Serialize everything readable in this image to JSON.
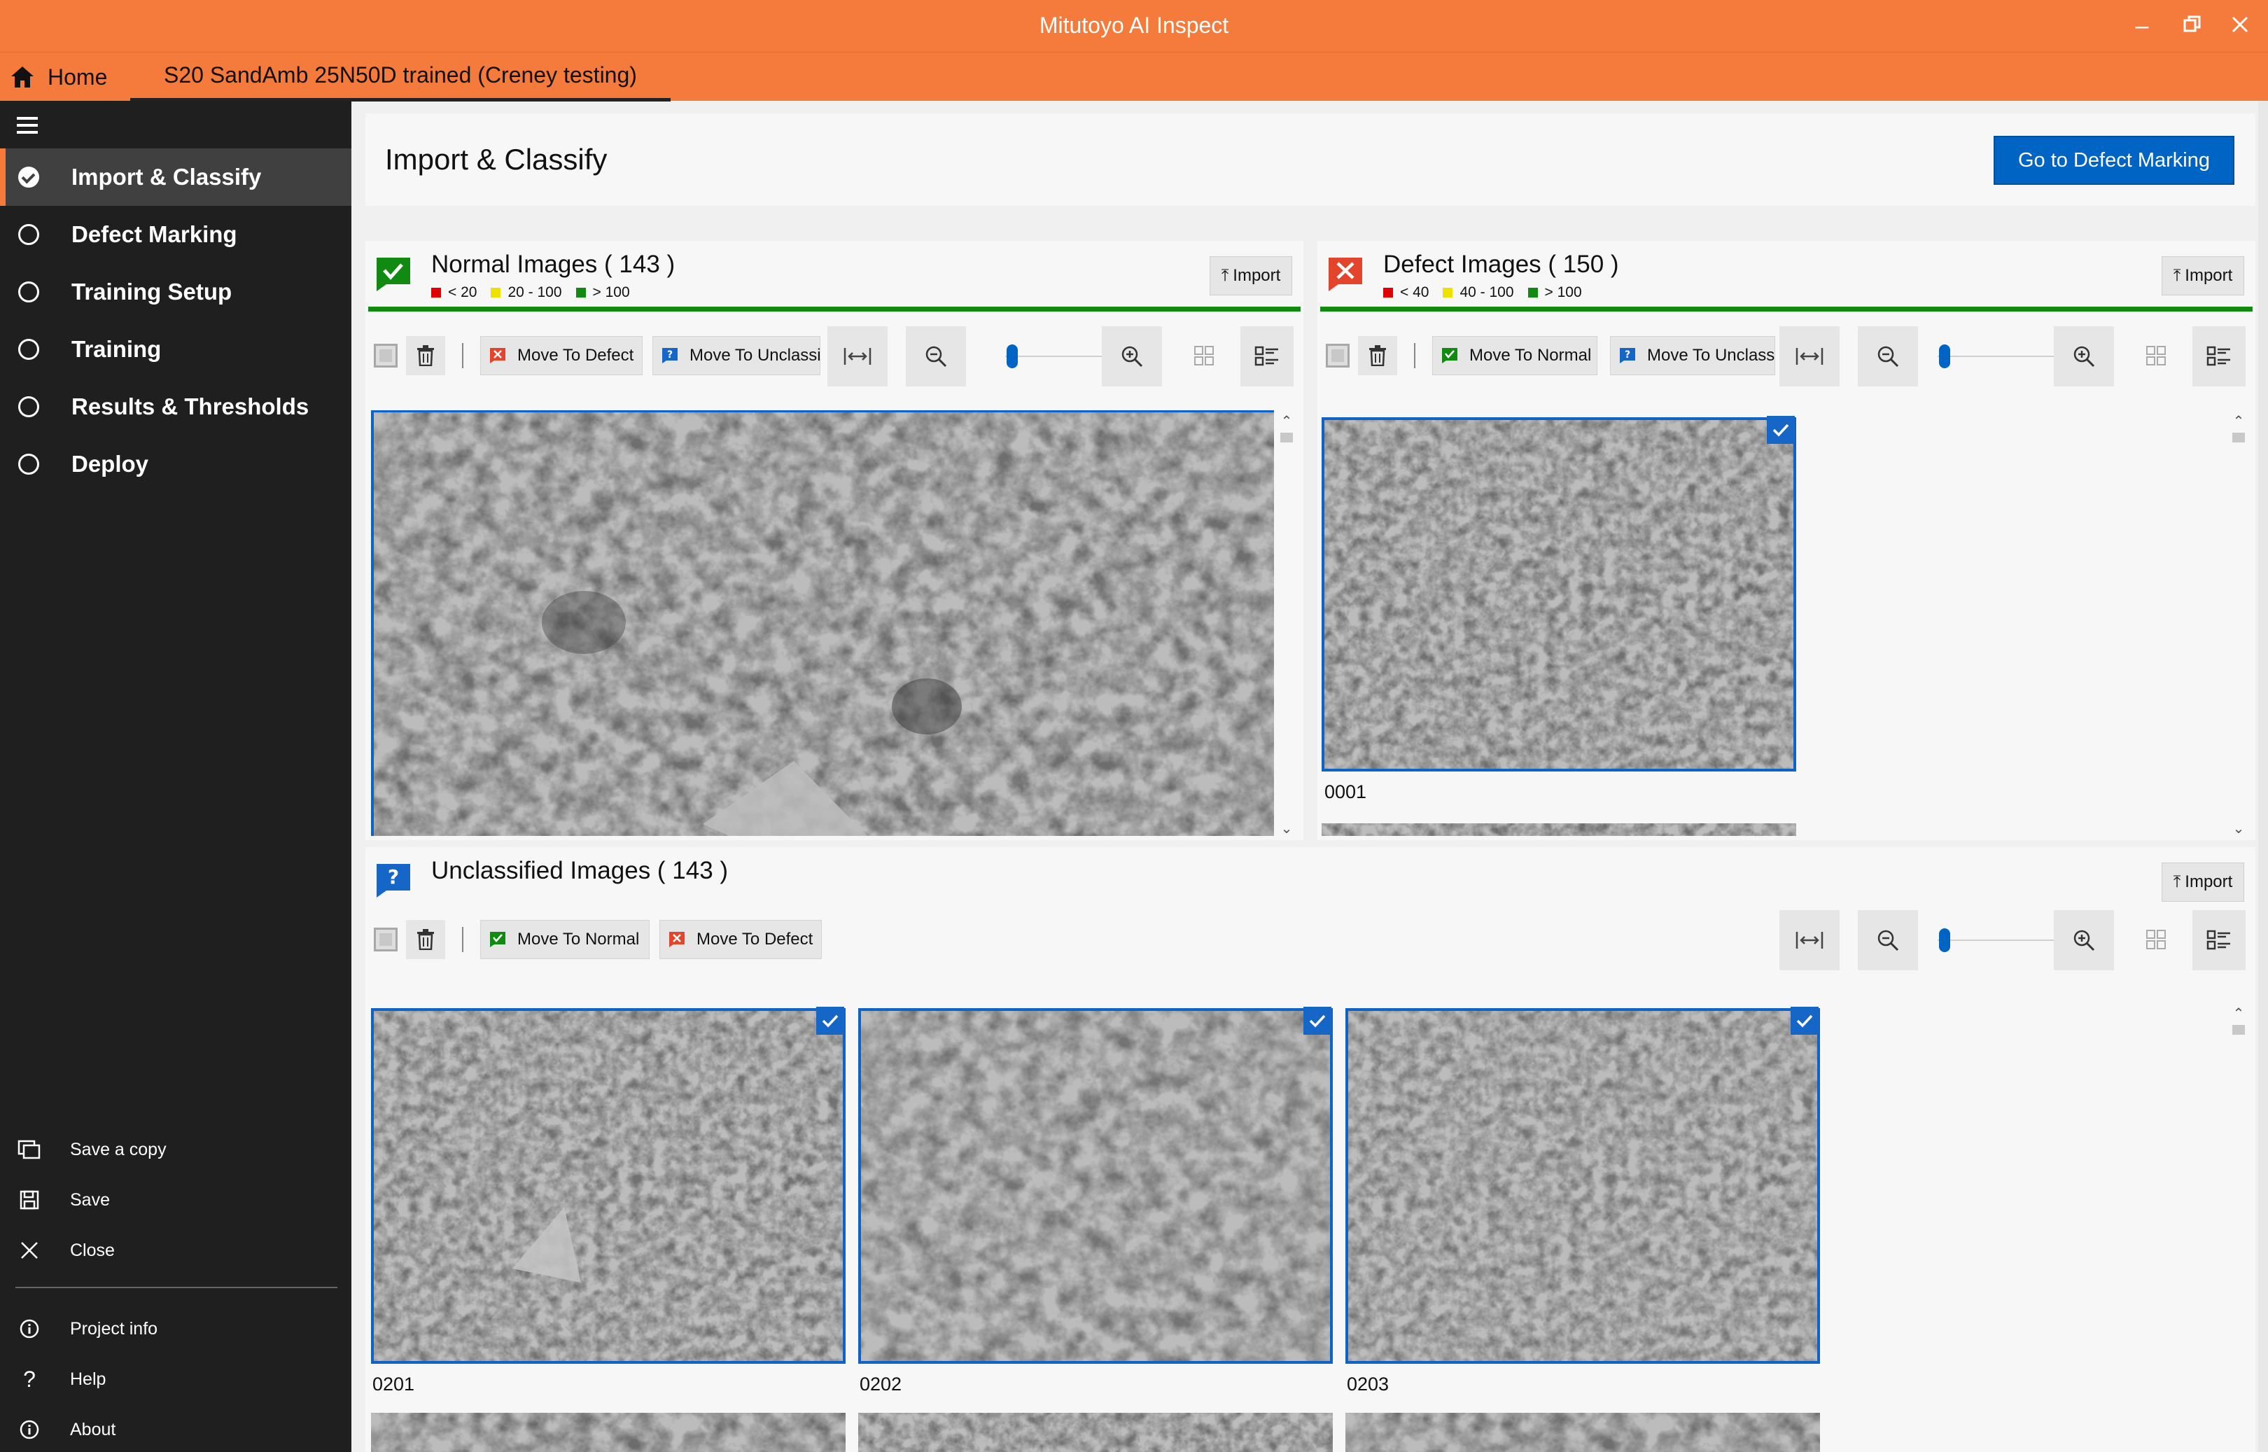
{
  "app": {
    "title": "Mitutoyo AI Inspect"
  },
  "tabs": {
    "home": "Home",
    "project": "S20 SandAmb 25N50D trained (Creney testing)"
  },
  "sidebar": {
    "items": [
      {
        "label": "Import & Classify",
        "active": true
      },
      {
        "label": "Defect Marking"
      },
      {
        "label": "Training Setup"
      },
      {
        "label": "Training"
      },
      {
        "label": "Results & Thresholds"
      },
      {
        "label": "Deploy"
      }
    ],
    "bottom": {
      "save_copy": "Save a copy",
      "save": "Save",
      "close": "Close",
      "project_info": "Project info",
      "help": "Help",
      "about": "About"
    }
  },
  "header": {
    "title": "Import & Classify",
    "action": "Go to Defect Marking"
  },
  "normal": {
    "title": "Normal Images ( 143 )",
    "legend": [
      "< 20",
      "20 - 100",
      "> 100"
    ],
    "import": "Import",
    "move_defect": "Move To Defect",
    "move_unclassified": "Move To Unclassified"
  },
  "defect": {
    "title": "Defect Images ( 150 )",
    "legend": [
      "< 40",
      "40 - 100",
      "> 100"
    ],
    "import": "Import",
    "move_normal": "Move To Normal",
    "move_unclassified": "Move To Unclassified",
    "images": [
      {
        "label": "0001"
      }
    ]
  },
  "unclassified": {
    "title": "Unclassified Images ( 143 )",
    "import": "Import",
    "move_normal": "Move To Normal",
    "move_defect": "Move To Defect",
    "images": [
      {
        "label": "0201"
      },
      {
        "label": "0202"
      },
      {
        "label": "0203"
      }
    ]
  },
  "colors": {
    "accent": "#f47b3b",
    "primary": "#0064c4",
    "normal_green": "#108a10",
    "defect_red": "#e2452c",
    "legend_red": "#e00000",
    "legend_yellow": "#f0e000",
    "legend_green": "#108a10"
  }
}
